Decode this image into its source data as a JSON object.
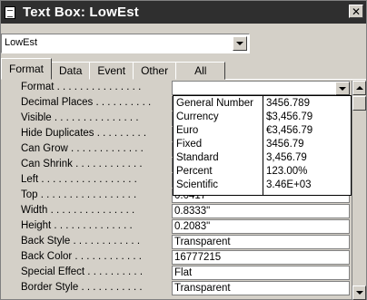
{
  "window": {
    "title": "Text Box: LowEst",
    "close_label": "✕"
  },
  "selector": {
    "value": "LowEst"
  },
  "tabs": [
    {
      "label": "Format"
    },
    {
      "label": "Data"
    },
    {
      "label": "Event"
    },
    {
      "label": "Other"
    },
    {
      "label": "All"
    }
  ],
  "properties": [
    {
      "label": "Format . . . . . . . . . . . . . . .",
      "value": ""
    },
    {
      "label": "Decimal Places . . . . . . . . . .",
      "value": ""
    },
    {
      "label": "Visible . . . . . . . . . . . . . . .",
      "value": ""
    },
    {
      "label": "Hide Duplicates . . . . . . . . .",
      "value": ""
    },
    {
      "label": "Can Grow . . . . . . . . . . . . .",
      "value": ""
    },
    {
      "label": "Can Shrink . . . . . . . . . . . .",
      "value": ""
    },
    {
      "label": "Left . . . . . . . . . . . . . . . . .",
      "value": ""
    },
    {
      "label": "Top . . . . . . . . . . . . . . . . .",
      "value": "0.0417\""
    },
    {
      "label": "Width . . . . . . . . . . . . . . .",
      "value": "0.8333\""
    },
    {
      "label": "Height . . . . . . . . . . . . . .",
      "value": "0.2083\""
    },
    {
      "label": "Back Style . . . . . . . . . . . .",
      "value": "Transparent"
    },
    {
      "label": "Back Color . . . . . . . . . . . .",
      "value": "16777215"
    },
    {
      "label": "Special Effect . . . . . . . . . .",
      "value": "Flat"
    },
    {
      "label": "Border Style . . . . . . . . . . .",
      "value": "Transparent"
    }
  ],
  "format_options": [
    {
      "name": "General Number",
      "sample": "3456.789"
    },
    {
      "name": "Currency",
      "sample": "$3,456.79"
    },
    {
      "name": "Euro",
      "sample": "€3,456.79"
    },
    {
      "name": "Fixed",
      "sample": "3456.79"
    },
    {
      "name": "Standard",
      "sample": "3,456.79"
    },
    {
      "name": "Percent",
      "sample": "123.00%"
    },
    {
      "name": "Scientific",
      "sample": "3.46E+03"
    }
  ]
}
